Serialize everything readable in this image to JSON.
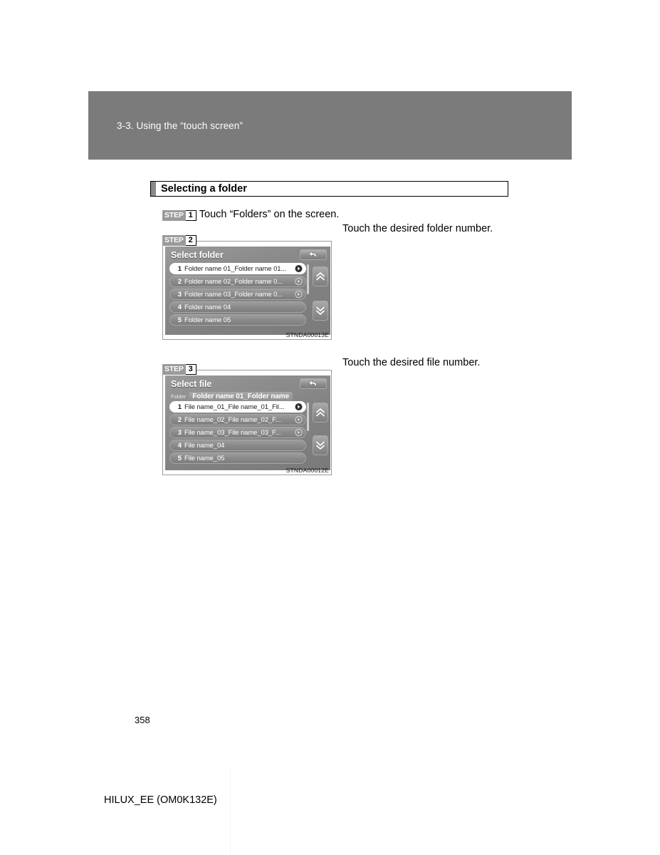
{
  "chapter": {
    "header_title": "3-3. Using the “touch screen”"
  },
  "section": {
    "title": "Selecting a folder"
  },
  "steps": [
    {
      "word": "STEP",
      "number": "1",
      "text": "Touch “Folders” on the screen."
    },
    {
      "word": "STEP",
      "number": "2",
      "callout": "Touch the desired folder number.",
      "image_code": "STNDA00013E"
    },
    {
      "word": "STEP",
      "number": "3",
      "callout": "Touch the desired file number.",
      "image_code": "STNDA00012E"
    }
  ],
  "screen_folder": {
    "title": "Select folder",
    "back_icon": "back-arrow-icon",
    "rows": [
      {
        "num": "1",
        "label": "Folder name 01_Folder name 01...",
        "arrow": true,
        "selected": true
      },
      {
        "num": "2",
        "label": "Folder name 02_Folder name 0...",
        "arrow": true,
        "selected": false
      },
      {
        "num": "3",
        "label": "Folder name 03_Folder name 0...",
        "arrow": true,
        "selected": false
      },
      {
        "num": "4",
        "label": "Folder name 04",
        "arrow": false,
        "selected": false
      },
      {
        "num": "5",
        "label": "Folder name 05",
        "arrow": false,
        "selected": false
      }
    ],
    "scroll_up_icon": "chevron-double-up-icon",
    "scroll_down_icon": "chevron-double-down-icon"
  },
  "screen_file": {
    "title": "Select file",
    "back_icon": "back-arrow-icon",
    "tab_kind_label": "Folder",
    "tab_name": "Folder name 01_Folder name",
    "rows": [
      {
        "num": "1",
        "label": "File name_01_File name_01_Fil...",
        "arrow": true,
        "selected": true
      },
      {
        "num": "2",
        "label": "File name_02_File name_02_F...",
        "arrow": true,
        "selected": false
      },
      {
        "num": "3",
        "label": "File name_03_File name_03_F...",
        "arrow": true,
        "selected": false
      },
      {
        "num": "4",
        "label": "File name_04",
        "arrow": false,
        "selected": false
      },
      {
        "num": "5",
        "label": "File name_05",
        "arrow": false,
        "selected": false
      }
    ],
    "scroll_up_icon": "chevron-double-up-icon",
    "scroll_down_icon": "chevron-double-down-icon"
  },
  "footer": {
    "page_number": "358",
    "doc_id": "HILUX_EE (OM0K132E)"
  },
  "colors": {
    "band": "#7b7b7b",
    "step_badge": "#9a9a9a",
    "screen_base": "#8a8a8a",
    "selected_row": "#ffffff"
  }
}
